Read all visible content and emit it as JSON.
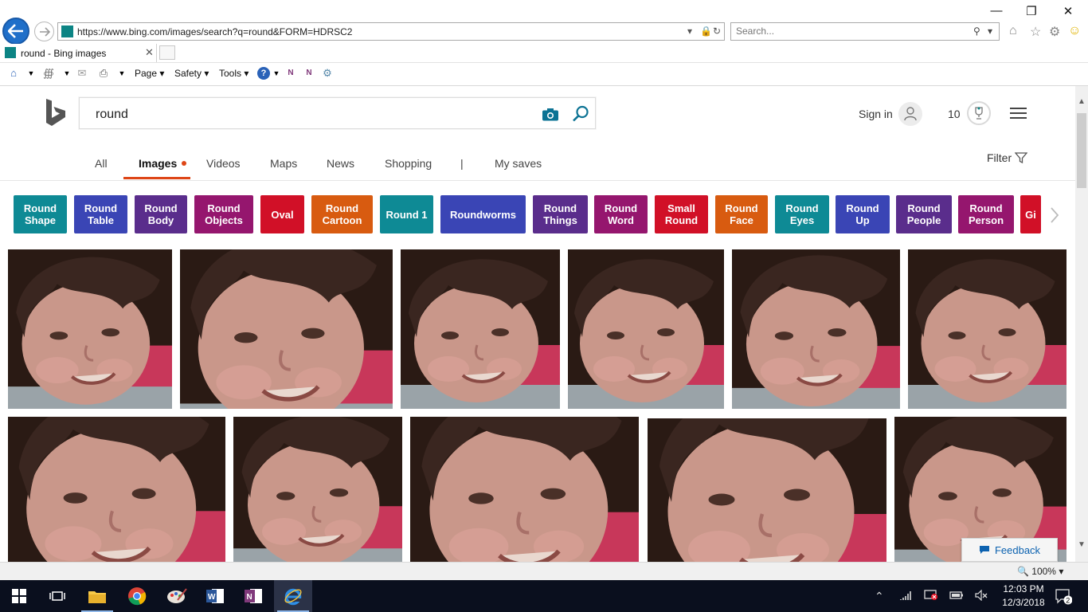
{
  "browser": {
    "url": "https://www.bing.com/images/search?q=round&FORM=HDRSC2",
    "search_placeholder": "Search...",
    "tab_title": "round - Bing images",
    "menus": [
      "Page",
      "Safety",
      "Tools"
    ]
  },
  "bing": {
    "query": "round",
    "sign_in": "Sign in",
    "rewards_count": "10",
    "nav": [
      "All",
      "Images",
      "Videos",
      "Maps",
      "News",
      "Shopping",
      "|",
      "My saves"
    ],
    "active_nav": "Images",
    "filter_label": "Filter",
    "chips": [
      {
        "label": "Round Shape",
        "color": "#0e8a95"
      },
      {
        "label": "Round Table",
        "color": "#3a45b5"
      },
      {
        "label": "Round Body",
        "color": "#5a2d8c"
      },
      {
        "label": "Round Objects",
        "color": "#95166e"
      },
      {
        "label": "Oval",
        "color": "#d11027"
      },
      {
        "label": "Round Cartoon",
        "color": "#d85b10"
      },
      {
        "label": "Round 1",
        "color": "#0e8a95"
      },
      {
        "label": "Roundworms",
        "color": "#3a45b5"
      },
      {
        "label": "Round Things",
        "color": "#5a2d8c"
      },
      {
        "label": "Round Word",
        "color": "#95166e"
      },
      {
        "label": "Small Round",
        "color": "#d11027"
      },
      {
        "label": "Round Face",
        "color": "#d85b10"
      },
      {
        "label": "Round Eyes",
        "color": "#0e8a95"
      },
      {
        "label": "Round Up",
        "color": "#3a45b5"
      },
      {
        "label": "Round People",
        "color": "#5a2d8c"
      },
      {
        "label": "Round Person",
        "color": "#95166e"
      },
      {
        "label": "Gi",
        "color": "#d11027"
      }
    ],
    "feedback_label": "Feedback"
  },
  "statusbar": {
    "zoom": "100%"
  },
  "taskbar": {
    "time": "12:03 PM",
    "date": "12/3/2018",
    "notification_count": "2"
  },
  "icons": [
    "back-arrow-icon",
    "forward-arrow-icon",
    "refresh-icon",
    "lock-icon",
    "home-icon",
    "star-icon",
    "gear-icon",
    "smiley-icon",
    "camera-icon",
    "search-icon",
    "trophy-icon",
    "hamburger-icon",
    "filter-icon",
    "chevron-right-icon",
    "windows-start-icon",
    "task-view-icon",
    "file-explorer-icon",
    "chrome-icon",
    "word-icon",
    "onenote-icon",
    "internet-explorer-icon"
  ]
}
